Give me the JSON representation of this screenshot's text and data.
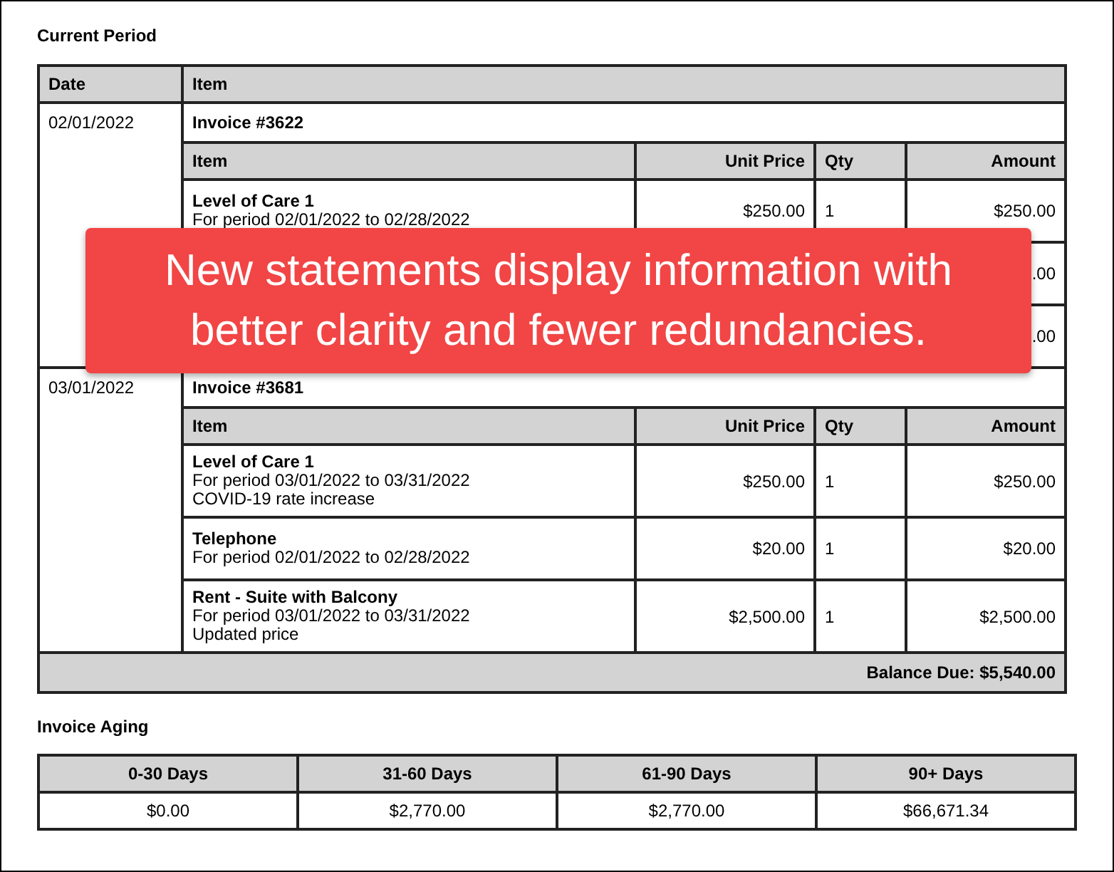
{
  "current_period": {
    "title": "Current Period",
    "columns": [
      "Date",
      "Item"
    ],
    "invoices": [
      {
        "date": "02/01/2022",
        "title": "Invoice #3622",
        "columns": [
          "Item",
          "Unit Price",
          "Qty",
          "Amount"
        ],
        "rows": [
          {
            "name": "Level of Care 1",
            "details": [
              "For period 02/01/2022 to 02/28/2022"
            ],
            "unit_price": "$250.00",
            "qty": "1",
            "amount": "$250.00"
          },
          {
            "amount": ".00"
          },
          {
            "amount": ".00"
          }
        ]
      },
      {
        "date": "03/01/2022",
        "title": "Invoice #3681",
        "columns": [
          "Item",
          "Unit Price",
          "Qty",
          "Amount"
        ],
        "rows": [
          {
            "name": "Level of Care 1",
            "details": [
              "For period 03/01/2022 to 03/31/2022",
              "COVID-19 rate increase"
            ],
            "unit_price": "$250.00",
            "qty": "1",
            "amount": "$250.00"
          },
          {
            "name": "Telephone",
            "details": [
              "For period 02/01/2022 to 02/28/2022"
            ],
            "unit_price": "$20.00",
            "qty": "1",
            "amount": "$20.00"
          },
          {
            "name": "Rent - Suite with Balcony",
            "details": [
              "For period 03/01/2022 to 03/31/2022",
              "Updated price"
            ],
            "unit_price": "$2,500.00",
            "qty": "1",
            "amount": "$2,500.00"
          }
        ]
      }
    ],
    "balance_due": "Balance Due: $5,540.00"
  },
  "invoice_aging": {
    "title": "Invoice Aging",
    "columns": [
      "0-30 Days",
      "31-60 Days",
      "61-90 Days",
      "90+ Days"
    ],
    "values": [
      "$0.00",
      "$2,770.00",
      "$2,770.00",
      "$66,671.34"
    ]
  },
  "callout": {
    "text": "New statements display information with better clarity and fewer redundancies."
  }
}
